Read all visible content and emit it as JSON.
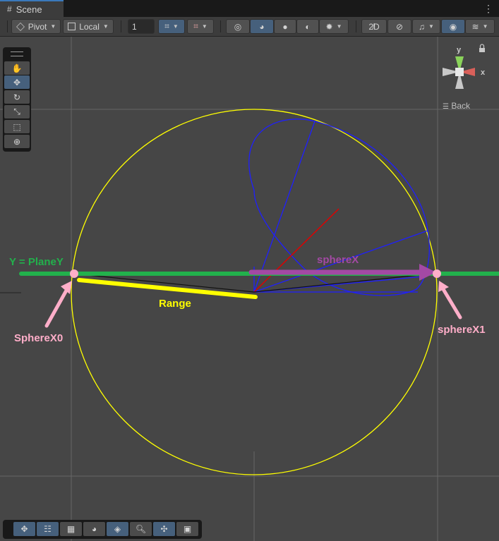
{
  "window": {
    "tab_title": "Scene",
    "tab_icon": "grid-icon",
    "menu_icon": "kebab-icon"
  },
  "toolbar": {
    "pivot_label": "Pivot",
    "local_label": "Local",
    "grid_snap_value": "1"
  },
  "gizmo": {
    "y_label": "y",
    "x_label": "x",
    "back_label": "Back",
    "lock_icon": "lock-icon"
  },
  "annotations": {
    "plane_label": "Y = PlaneY",
    "spherex_label": "sphereX",
    "range_label": "Range",
    "spherex0_label": "SphereX0",
    "spherex1_label": "sphereX1"
  },
  "colors": {
    "plane_line": "#22b14c",
    "sphere_circle": "#ffff00",
    "spherex_arrow": "#a349a4",
    "range_line": "#ffff00",
    "pink_markers": "#ffaec9",
    "blue_wire": "#0000ff",
    "red_ray": "#ff0000"
  }
}
